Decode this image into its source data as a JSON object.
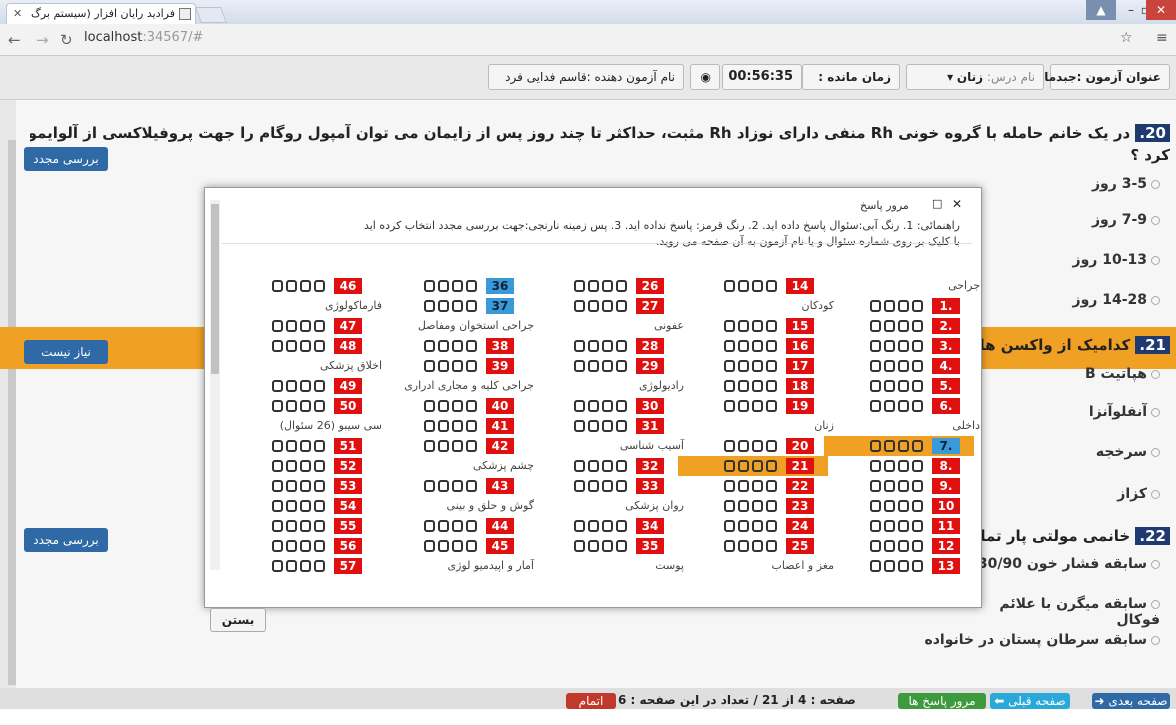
{
  "browser": {
    "tab_title": "فرادید رایان افزار (سیستم برگ",
    "url_host": "localhost",
    "url_rest": ":34567/#"
  },
  "exam_header": {
    "title": "عنوان آزمون :جبدمان الف",
    "lesson_label": "نام درس:",
    "lesson_value": "زنان",
    "remaining_label": "زمان مانده :",
    "remaining_time": "00:56:35",
    "examiner": "نام آزمون دهنده :قاسم فدایی فرد"
  },
  "question20": {
    "num": "20.",
    "text": "در یک خانم حامله با گروه خونی Rh منفی دارای نوزاد Rh مثبت، حداکثر تا چند روز پس از زایمان می توان آمپول روگام را جهت پروفیلاکسی از آلوایمونیزاسیون Rh تزریق",
    "text2": "کرد ؟",
    "options": [
      "3-5 روز",
      "7-9 روز",
      "10-13 روز",
      "14-28 روز"
    ],
    "review": "بررسی مجدد"
  },
  "question21": {
    "num": "21.",
    "text": "کدامیک از واکسن های",
    "options": [
      "هپاتیت B",
      "آنفلوآنزا",
      "سرخجه",
      "کزاز"
    ],
    "review": "نیاز نیست"
  },
  "question22": {
    "num": "22.",
    "text": "خانمی مولتی پار تمایل",
    "options": [
      "سابقه فشار خون 130/90",
      "سابقه میگرن با علائم فوکال",
      "سابقه سرطان پستان در خانواده"
    ],
    "review": "بررسی مجدد"
  },
  "footer": {
    "next": "صفحه بعدی",
    "prev": "صفحه قبلی",
    "review": "مرور پاسخ ها",
    "page_label": "صفحه :",
    "page": "4",
    "of_label": "از",
    "total": "21",
    "count_label": "/ تعداد در این صفحه :",
    "count": "6",
    "finish": "اتمام آزمون"
  },
  "modal": {
    "title": "مرور پاسخ",
    "help1": "راهنمائی: 1. رنگ آبی:سئوال پاسخ داده اید. 2. رنگ قرمز: پاسخ نداده اید. 3. پس زمینه نارنجی:جهت بررسی مجدد انتخاب کرده اید",
    "help2": "با کلیک بر روی شماره سئوال و یا نام آزمون به آن صفحه می روید.",
    "close": "بستن",
    "categories": [
      "جراحی",
      "داخلی",
      "کودکان",
      "زنان",
      "مغز و اعصاب",
      "عفونی",
      "رادیولوژی",
      "آسیب شناسی",
      "روان پزشکی",
      "پوست",
      "فارماکولوژی",
      "جراحی استخوان ومفاصل",
      "اخلاق پزشکی",
      "جراحی کلیه و مجاری ادراری",
      "چشم پزشکی",
      "گوش و حلق و بینی",
      "آمار و اپیدمیو لوژی",
      "سی سیبو (26 سئوال)"
    ],
    "questions": [
      "1.",
      "2.",
      "3.",
      "4.",
      "5.",
      "6.",
      "7.",
      "8.",
      "9.",
      "10",
      "11",
      "12",
      "13",
      "14",
      "15",
      "16",
      "17",
      "18",
      "19",
      "20",
      "21",
      "22",
      "23",
      "24",
      "25",
      "26",
      "27",
      "28",
      "29",
      "30",
      "31",
      "32",
      "33",
      "34",
      "35",
      "36",
      "37",
      "38",
      "39",
      "40",
      "41",
      "42",
      "43",
      "44",
      "45",
      "46",
      "47",
      "48",
      "49",
      "50",
      "51",
      "52",
      "53",
      "54",
      "55",
      "56",
      "57"
    ]
  },
  "colors": {
    "unanswered": "#e01010",
    "answered": "#3a9ad9",
    "review": "#f0a124"
  }
}
